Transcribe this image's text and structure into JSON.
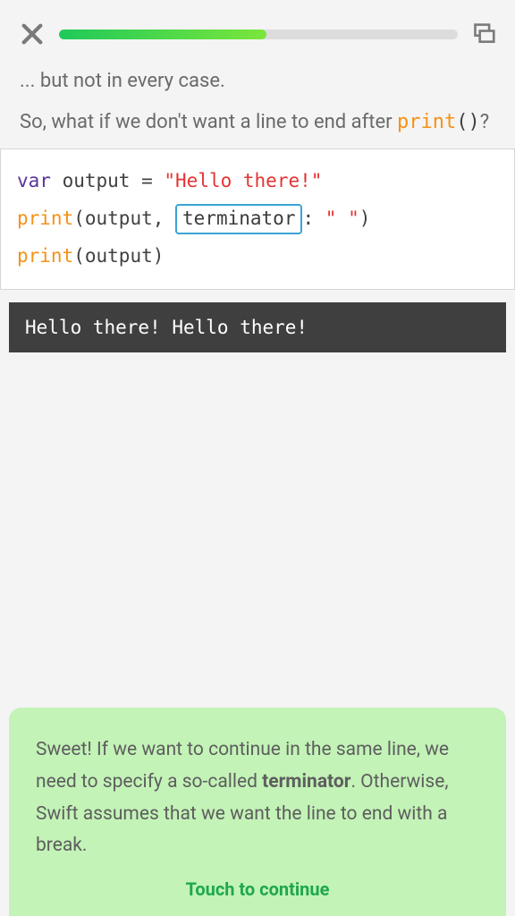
{
  "progress": {
    "percent": 52
  },
  "lesson": {
    "line1": "... but not in every case.",
    "line2_pre": "So, what if we don't want a line to end after ",
    "line2_code": "print",
    "line2_parens": "()",
    "line2_post": "?"
  },
  "code": {
    "kw_var": "var",
    "id_output": "output",
    "eq": " = ",
    "str_hello": "\"Hello there!\"",
    "fn_print": "print",
    "lparen": "(",
    "rparen": ")",
    "arg_output1": "output",
    "comma_sp": ", ",
    "blank_value": "terminator",
    "colon": ":",
    "sp": " ",
    "str_space": "\" \"",
    "arg_output2": "output"
  },
  "output": "Hello there! Hello there!",
  "feedback": {
    "text_pre": "Sweet! If we want to continue in the same line, we need to specify a so-called ",
    "text_bold": "terminator",
    "text_post": ". Otherwise, Swift assumes that we want the line to end with a break.",
    "cta": "Touch to continue"
  }
}
